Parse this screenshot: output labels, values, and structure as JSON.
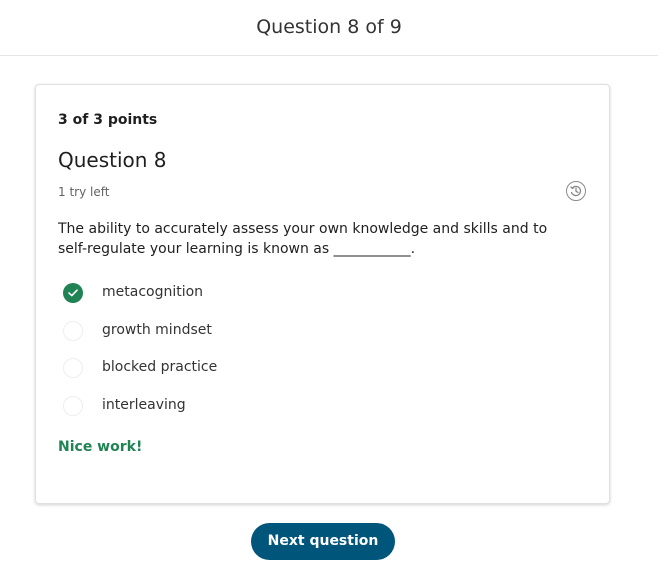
{
  "header": {
    "title": "Question 8 of 9"
  },
  "question": {
    "points": "3 of 3 points",
    "title": "Question 8",
    "tries_left": "1 try left",
    "prompt": "The ability to accurately assess your own knowledge and skills and to self-regulate your learning is known as ___________.",
    "history_icon": "history-icon",
    "options": [
      {
        "label": "metacognition",
        "selected": true,
        "correct": true
      },
      {
        "label": "growth mindset",
        "selected": false
      },
      {
        "label": "blocked practice",
        "selected": false
      },
      {
        "label": "interleaving",
        "selected": false
      }
    ],
    "feedback": "Nice work!"
  },
  "footer": {
    "next_label": "Next question"
  },
  "colors": {
    "accent": "#00557a",
    "success": "#1f8354"
  }
}
